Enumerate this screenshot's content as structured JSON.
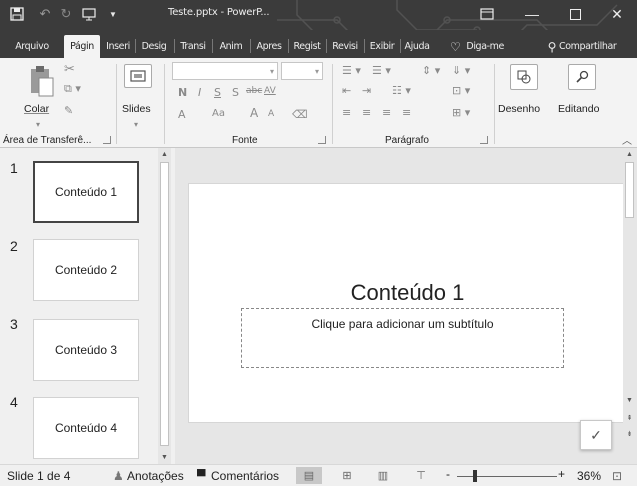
{
  "window": {
    "title": "Teste.pptx  -  PowerP...",
    "quick_access": [
      "save-icon",
      "undo-icon",
      "redo-icon",
      "start-presentation-icon",
      "customize-icon"
    ],
    "controls": [
      "ribbon-display-icon",
      "minimize-icon",
      "maximize-icon",
      "close-icon"
    ]
  },
  "ribbon_tabs": [
    {
      "label": "Arquivo"
    },
    {
      "label": "Págin",
      "active": true
    },
    {
      "label": "Inseri"
    },
    {
      "label": "Desig"
    },
    {
      "label": "Transi"
    },
    {
      "label": "Anim"
    },
    {
      "label": "Apres"
    },
    {
      "label": "Regist"
    },
    {
      "label": "Revisi"
    },
    {
      "label": "Exibir"
    },
    {
      "label": "Ajuda"
    },
    {
      "label": "Diga-me"
    },
    {
      "label": "Compartilhar"
    }
  ],
  "ribbon": {
    "clipboard": {
      "paste_label": "Colar",
      "group_label": "Área de Transferê..."
    },
    "slides": {
      "label": "Slides"
    },
    "font": {
      "group_label": "Fonte",
      "format_buttons": [
        "N",
        "I",
        "S",
        "S",
        "abc",
        "AV"
      ],
      "size_buttons": [
        "A",
        "Aa",
        "A",
        "A"
      ]
    },
    "paragraph": {
      "group_label": "Parágrafo"
    },
    "drawing": {
      "label": "Desenho"
    },
    "editing": {
      "label": "Editando"
    }
  },
  "thumbnails": [
    {
      "number": "1",
      "text": "Conteúdo 1",
      "selected": true
    },
    {
      "number": "2",
      "text": "Conteúdo 2"
    },
    {
      "number": "3",
      "text": "Conteúdo 3"
    },
    {
      "number": "4",
      "text": "Conteúdo 4"
    }
  ],
  "slide": {
    "title": "Conteúdo 1",
    "subtitle_placeholder": "Clique para adicionar um subtítulo"
  },
  "statusbar": {
    "slide_info": "Slide 1 de 4",
    "notes_label": "Anotações",
    "comments_label": "Comentários",
    "zoom_minus": "-",
    "zoom_plus": "+",
    "zoom_level": "36%"
  },
  "colors": {
    "titlebar_bg": "#3b3b3b",
    "ribbon_bg": "#f3f3f3",
    "pane_bg": "#f0f0f0",
    "edit_bg": "#e6e6e6"
  }
}
